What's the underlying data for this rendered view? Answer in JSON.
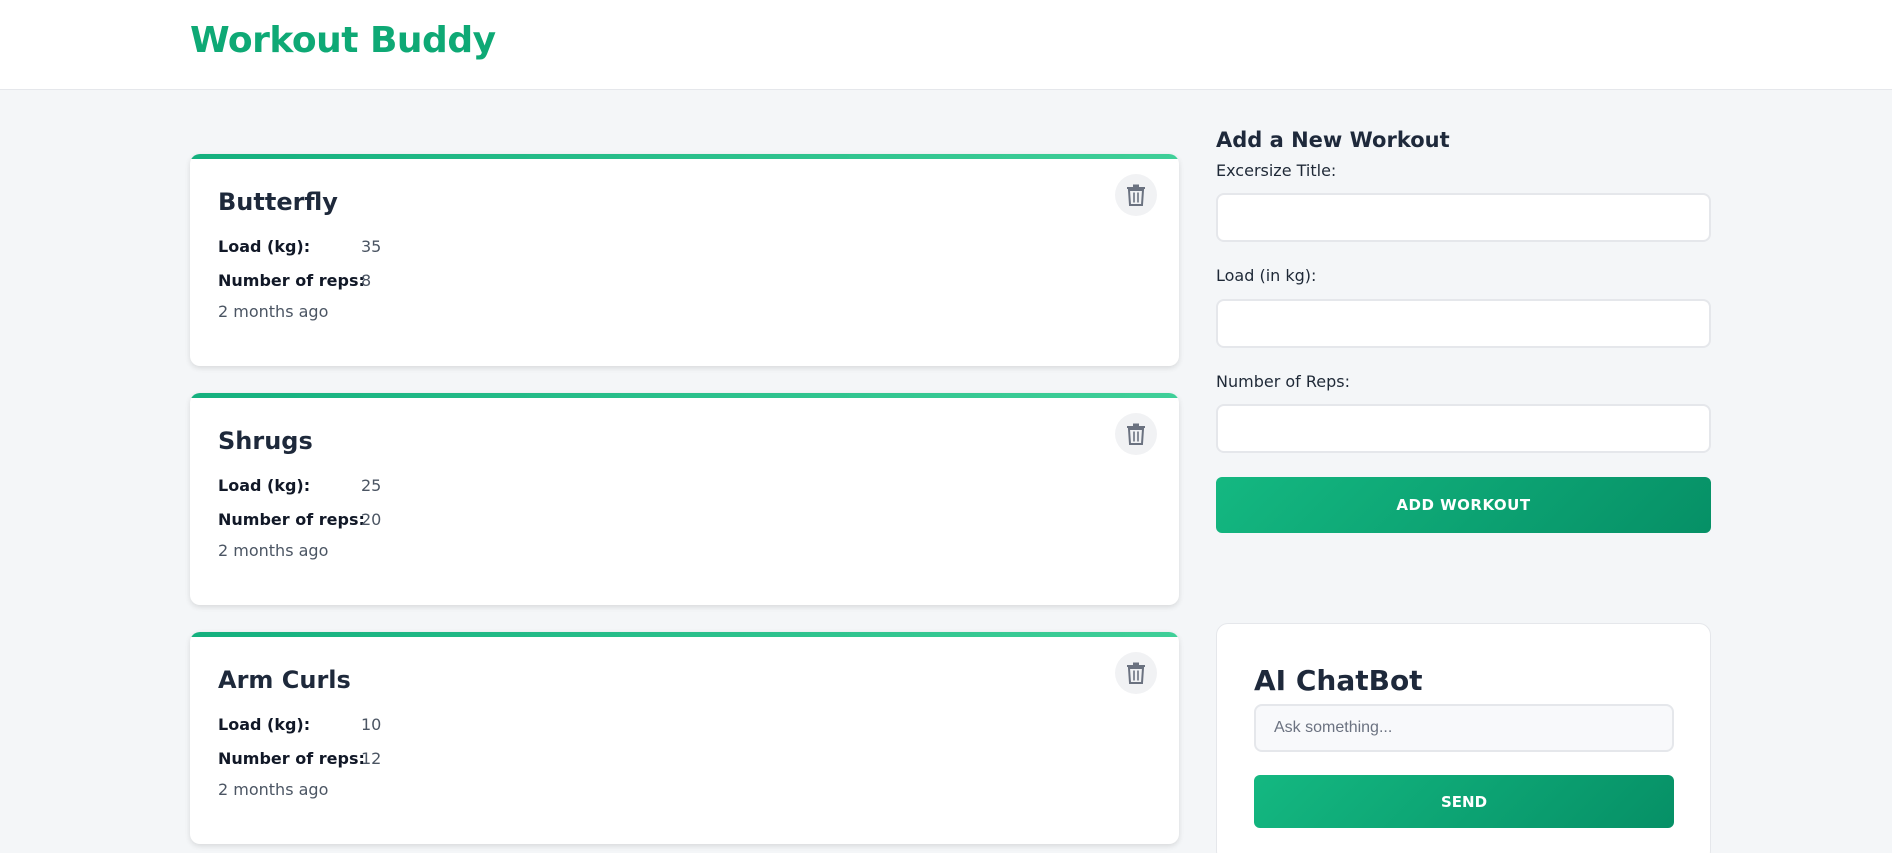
{
  "app": {
    "title": "Workout Buddy"
  },
  "workouts": [
    {
      "title": "Butterfly",
      "load_label": "Load (kg):",
      "load": "35",
      "reps_label": "Number of reps:",
      "reps": "8",
      "time": "2 months ago"
    },
    {
      "title": "Shrugs",
      "load_label": "Load (kg):",
      "load": "25",
      "reps_label": "Number of reps:",
      "reps": "20",
      "time": "2 months ago"
    },
    {
      "title": "Arm Curls",
      "load_label": "Load (kg):",
      "load": "10",
      "reps_label": "Number of reps:",
      "reps": "12",
      "time": "2 months ago"
    }
  ],
  "form": {
    "heading": "Add a New Workout",
    "title_label": "Excersize Title:",
    "title_value": "",
    "load_label": "Load (in kg):",
    "load_value": "",
    "reps_label": "Number of Reps:",
    "reps_value": "",
    "submit_label": "ADD WORKOUT"
  },
  "chatbot": {
    "title": "AI ChatBot",
    "placeholder": "Ask something...",
    "send_label": "SEND"
  },
  "icons": {
    "delete": "trash-icon"
  },
  "colors": {
    "brand": "#0ea975",
    "accent_gradient_start": "#14b881",
    "accent_gradient_end": "#069066"
  }
}
